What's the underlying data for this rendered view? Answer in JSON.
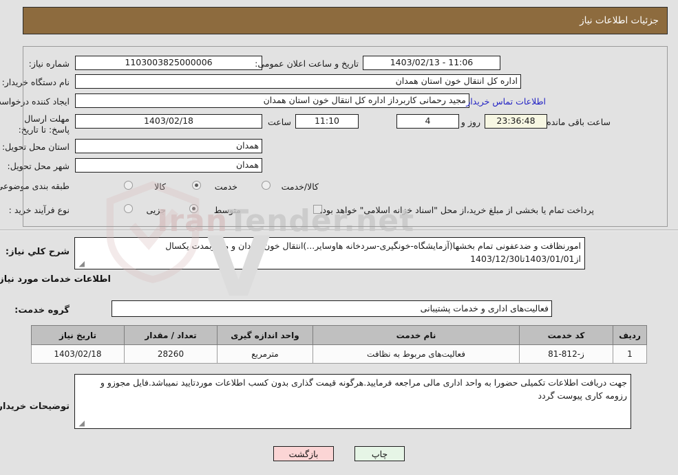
{
  "window": {
    "title": "جزئیات اطلاعات نیاز"
  },
  "colors": {
    "header_bar": "#8d6b3e",
    "page_background": "#e2e2e2",
    "table_header": "#c0c0c0",
    "link": "#2323c4",
    "print_button": "#e6f5e6",
    "back_button": "#fbd5d5",
    "countdown_field": "#f7f7e3"
  },
  "form": {
    "need_number": {
      "label": "شماره نیاز:",
      "value": "1103003825000006"
    },
    "announcement_datetime": {
      "label": "تاریخ و ساعت اعلان عمومی:",
      "value": "1403/02/13 - 11:06"
    },
    "buyer_organization": {
      "label": "نام دستگاه خریدار:",
      "value": "اداره کل انتقال خون استان همدان"
    },
    "request_creator": {
      "label": "ایجاد کننده درخواست:",
      "value": "مجید رحمانی کاربرداز اداره کل انتقال خون استان همدان"
    },
    "buyer_contact_link": "اطلاعات تماس خریدار",
    "response_deadline": {
      "label": "مهلت ارسال پاسخ: تا تاریخ:",
      "date": "1403/02/18",
      "time_label": "ساعت",
      "time": "11:10",
      "days_value": "4",
      "days_label": "روز و",
      "countdown": "23:36:48",
      "remaining_label": "ساعت باقی مانده"
    },
    "delivery_province": {
      "label": "استان محل تحویل:",
      "value": "همدان"
    },
    "delivery_city": {
      "label": "شهر محل تحویل:",
      "value": "همدان"
    },
    "subject_classification": {
      "label": "طبقه بندی موضوعی:",
      "options": [
        {
          "label": "کالا",
          "selected": false
        },
        {
          "label": "خدمت",
          "selected": true
        },
        {
          "label": "کالا/خدمت",
          "selected": false
        }
      ]
    },
    "purchase_process_type": {
      "label": "نوع فرآیند خرید :",
      "options": [
        {
          "label": "جزیی",
          "selected": false
        },
        {
          "label": "متوسط",
          "selected": true
        }
      ],
      "checkbox": {
        "label": "پرداخت تمام یا بخشی از مبلغ خرید،از محل \"اسناد خزانه اسلامی\" خواهد بود.",
        "checked": false
      }
    }
  },
  "general_description": {
    "label": "شرح کلي نیاز:",
    "value": "امورنظافت و ضدعفونی تمام بخشها(آزمایشگاه-خونگیری-سردخانه هاوسایر...)انتقال خون همدان و ملایربمدت یکسال از1403/01/01تا1403/12/30"
  },
  "services_section": {
    "heading": "اطلاعات خدمات مورد نیاز",
    "service_group": {
      "label": "گروه خدمت:",
      "value": "فعالیت‌های اداری و خدمات پشتیبانی"
    },
    "table": {
      "columns": [
        "ردیف",
        "کد خدمت",
        "نام خدمت",
        "واحد اندازه گیری",
        "تعداد / مقدار",
        "تاریخ نیاز"
      ],
      "rows": [
        {
          "row_no": "1",
          "service_code": "ز-812-81",
          "service_name": "فعالیت‌های مربوط به نظافت",
          "unit": "مترمربع",
          "quantity": "28260",
          "need_date": "1403/02/18"
        }
      ]
    }
  },
  "buyer_notes": {
    "label": "توضیحات خریدار:",
    "value": "جهت دریافت اطلاعات تکمیلی حضورا به واحد اداری مالی مراجعه فرمایید.هرگونه قیمت گذاری بدون کسب اطلاعات موردتایید نمیباشد.فایل مجوزو و رزومه کاری پیوست گردد"
  },
  "actions": {
    "print": "چاپ",
    "back": "بازگشت"
  },
  "watermark": {
    "text_left": "Iran",
    "text_right": "Tender",
    "text_suffix": ".net"
  }
}
